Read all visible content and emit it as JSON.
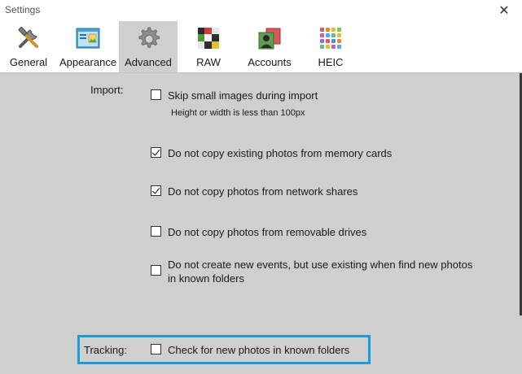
{
  "window": {
    "title": "Settings",
    "close_glyph": "✕"
  },
  "tabs": [
    {
      "label": "General",
      "icon": "tools-icon"
    },
    {
      "label": "Appearance",
      "icon": "window-appearance-icon"
    },
    {
      "label": "Advanced",
      "icon": "gear-icon",
      "active": true
    },
    {
      "label": "RAW",
      "icon": "raw-color-grid-icon"
    },
    {
      "label": "Accounts",
      "icon": "accounts-icon"
    },
    {
      "label": "HEIC",
      "icon": "heic-grid-icon"
    }
  ],
  "import": {
    "label": "Import:",
    "options": [
      {
        "label": "Skip small images during import",
        "checked": false,
        "hint": "Height or width is less than 100px"
      },
      {
        "label": "Do not copy existing photos from memory cards",
        "checked": true
      },
      {
        "label": "Do not copy photos from network shares",
        "checked": true
      },
      {
        "label": "Do not copy photos from removable drives",
        "checked": false
      },
      {
        "label_line1": "Do not create new events, but use existing when find new photos",
        "label_line2": "in known folders",
        "checked": false
      }
    ]
  },
  "tracking": {
    "label": "Tracking:",
    "option": {
      "label": "Check for new photos in known folders",
      "checked": false
    },
    "highlight_color": "#1e9cd7"
  }
}
